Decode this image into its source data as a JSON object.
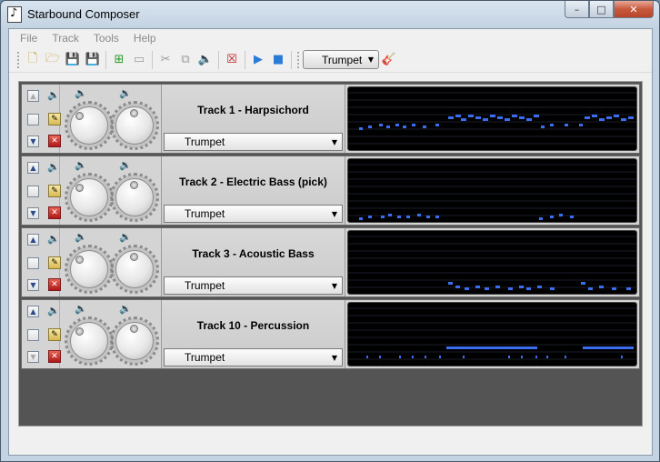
{
  "window": {
    "title": "Starbound Composer"
  },
  "window_buttons": {
    "minimize": "–",
    "maximize": "□",
    "close": "✕"
  },
  "menubar": {
    "items": [
      "File",
      "Track",
      "Tools",
      "Help"
    ]
  },
  "toolbar": {
    "instrument_selected": "Trumpet",
    "icons": [
      "new-file-icon",
      "open-file-icon",
      "save-icon",
      "save-as-icon",
      "add-track-icon",
      "remove-track-icon",
      "cut-icon",
      "copy-icon",
      "mute-icon",
      "delete-track-icon",
      "play-icon",
      "stop-icon",
      "guitar-icon"
    ]
  },
  "tracks": [
    {
      "name": "Track 1 - Harpsichord",
      "instrument": "Trumpet",
      "up_enabled": false,
      "down_enabled": true,
      "notes": [
        [
          12,
          44,
          4
        ],
        [
          22,
          42,
          4
        ],
        [
          34,
          40,
          4
        ],
        [
          42,
          42,
          4
        ],
        [
          52,
          40,
          4
        ],
        [
          60,
          42,
          4
        ],
        [
          70,
          40,
          4
        ],
        [
          82,
          42,
          4
        ],
        [
          96,
          40,
          4
        ],
        [
          110,
          32,
          6
        ],
        [
          118,
          30,
          6
        ],
        [
          124,
          34,
          6
        ],
        [
          132,
          30,
          6
        ],
        [
          140,
          32,
          6
        ],
        [
          148,
          34,
          6
        ],
        [
          156,
          30,
          6
        ],
        [
          164,
          32,
          6
        ],
        [
          172,
          34,
          6
        ],
        [
          180,
          30,
          6
        ],
        [
          188,
          32,
          6
        ],
        [
          196,
          34,
          6
        ],
        [
          204,
          30,
          6
        ],
        [
          212,
          42,
          4
        ],
        [
          222,
          40,
          4
        ],
        [
          238,
          40,
          4
        ],
        [
          254,
          40,
          4
        ],
        [
          260,
          32,
          6
        ],
        [
          268,
          30,
          6
        ],
        [
          276,
          34,
          6
        ],
        [
          284,
          32,
          6
        ],
        [
          292,
          30,
          6
        ],
        [
          300,
          34,
          6
        ],
        [
          308,
          32,
          6
        ]
      ]
    },
    {
      "name": "Track 2 - Electric Bass (pick)",
      "instrument": "Trumpet",
      "up_enabled": true,
      "down_enabled": true,
      "notes": [
        [
          12,
          64,
          4
        ],
        [
          22,
          62,
          4
        ],
        [
          36,
          62,
          4
        ],
        [
          44,
          60,
          4
        ],
        [
          54,
          62,
          4
        ],
        [
          64,
          62,
          4
        ],
        [
          76,
          60,
          4
        ],
        [
          86,
          62,
          4
        ],
        [
          96,
          62,
          4
        ],
        [
          210,
          64,
          4
        ],
        [
          222,
          62,
          4
        ],
        [
          232,
          60,
          4
        ],
        [
          244,
          62,
          4
        ]
      ]
    },
    {
      "name": "Track 3 - Acoustic Bass",
      "instrument": "Trumpet",
      "up_enabled": true,
      "down_enabled": true,
      "notes": [
        [
          110,
          56,
          5
        ],
        [
          118,
          60,
          5
        ],
        [
          128,
          62,
          5
        ],
        [
          140,
          60,
          5
        ],
        [
          150,
          62,
          5
        ],
        [
          162,
          60,
          5
        ],
        [
          176,
          62,
          5
        ],
        [
          188,
          60,
          5
        ],
        [
          196,
          62,
          5
        ],
        [
          208,
          60,
          5
        ],
        [
          222,
          62,
          5
        ],
        [
          256,
          56,
          5
        ],
        [
          264,
          62,
          5
        ],
        [
          276,
          60,
          5
        ],
        [
          290,
          62,
          5
        ],
        [
          306,
          62,
          5
        ]
      ]
    },
    {
      "name": "Track 10 - Percussion",
      "instrument": "Trumpet",
      "up_enabled": true,
      "down_enabled": false,
      "notes": [
        [
          20,
          58,
          2
        ],
        [
          34,
          58,
          2
        ],
        [
          56,
          58,
          2
        ],
        [
          70,
          58,
          2
        ],
        [
          84,
          58,
          2
        ],
        [
          100,
          58,
          2
        ],
        [
          108,
          48,
          100
        ],
        [
          126,
          58,
          2
        ],
        [
          176,
          58,
          2
        ],
        [
          190,
          58,
          2
        ],
        [
          206,
          58,
          2
        ],
        [
          218,
          58,
          2
        ],
        [
          238,
          58,
          2
        ],
        [
          258,
          48,
          56
        ],
        [
          300,
          58,
          2
        ]
      ]
    }
  ],
  "colors": {
    "note": "#3a6df0",
    "roll_bg": "#000000",
    "roll_line": "#1c1c2a",
    "tracklist_bg": "#545454"
  }
}
